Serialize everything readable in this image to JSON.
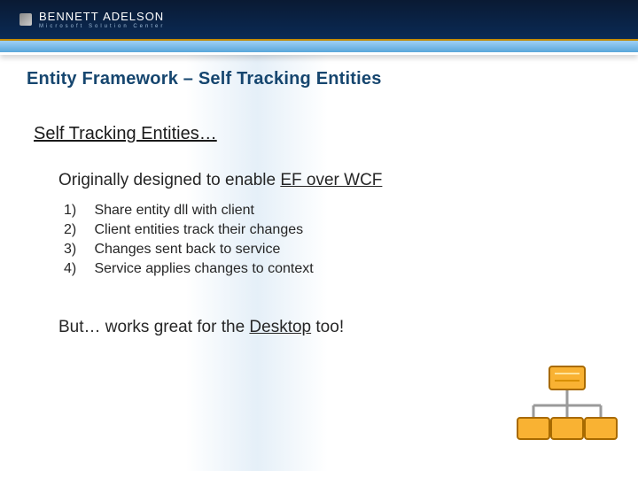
{
  "brand": {
    "name_part1": "BENNETT",
    "name_part2": "ADELSON",
    "tagline": "Microsoft Solution Center"
  },
  "title": "Entity Framework – Self Tracking Entities",
  "subhead": "Self Tracking Entities…",
  "intro_prefix": "Originally designed to enable ",
  "intro_underline": "EF over WCF",
  "steps": [
    {
      "num": "1)",
      "text": "Share entity dll with client"
    },
    {
      "num": "2)",
      "text": "Client entities track their changes"
    },
    {
      "num": "3)",
      "text": "Changes sent back to service"
    },
    {
      "num": "4)",
      "text": "Service applies changes to context"
    }
  ],
  "closing_prefix": "But… works great for the ",
  "closing_underline": "Desktop",
  "closing_suffix": " too!",
  "icon_colors": {
    "box_fill": "#f9b233",
    "box_stroke": "#a86a00",
    "line": "#9a9a9a"
  }
}
